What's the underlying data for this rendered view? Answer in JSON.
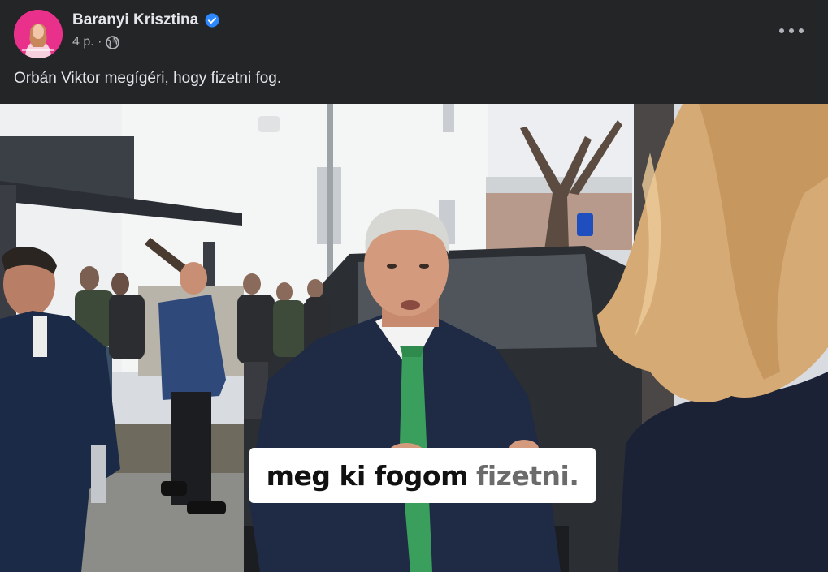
{
  "post": {
    "author": {
      "name": "Baranyi Krisztina",
      "verified": true
    },
    "timestamp": "4 p. ·",
    "audience_icon": "globe-icon",
    "more_icon": "more-options-icon",
    "text": "Orbán Viktor megígéri, hogy fizetni fog."
  },
  "media": {
    "caption": {
      "main": "meg ki fogom",
      "accent": "fizetni."
    },
    "colors": {
      "tie": "#3a9e5c",
      "suit": "#1f2a44",
      "caption_bg": "#ffffff"
    }
  },
  "colors": {
    "background": "#242526",
    "primary_text": "#e4e6eb",
    "secondary_text": "#b0b3b8",
    "verified_badge": "#2d88ff",
    "avatar_bg": "#e9308a"
  }
}
